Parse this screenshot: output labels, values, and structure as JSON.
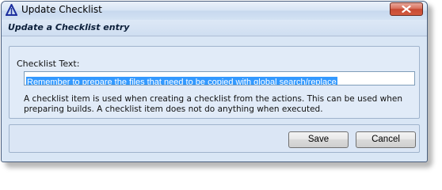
{
  "window": {
    "title": "Update Checklist",
    "header": "Update a Checklist entry"
  },
  "form": {
    "label": "Checklist Text:",
    "input_value": "Remember to prepare the files that need to be copied with global search/replace",
    "help_line1": "A checklist item is used when creating a checklist from the actions.  This can be used  when",
    "help_line2": "preparing builds.  A checklist item does not do anything when executed."
  },
  "buttons": {
    "save": "Save",
    "cancel": "Cancel"
  },
  "colors": {
    "selection": "#3399ff",
    "close_button": "#c74a33",
    "window_bg": "#d9e6f5"
  },
  "icons": {
    "app": "triangle-logo-icon",
    "close": "close-icon"
  }
}
